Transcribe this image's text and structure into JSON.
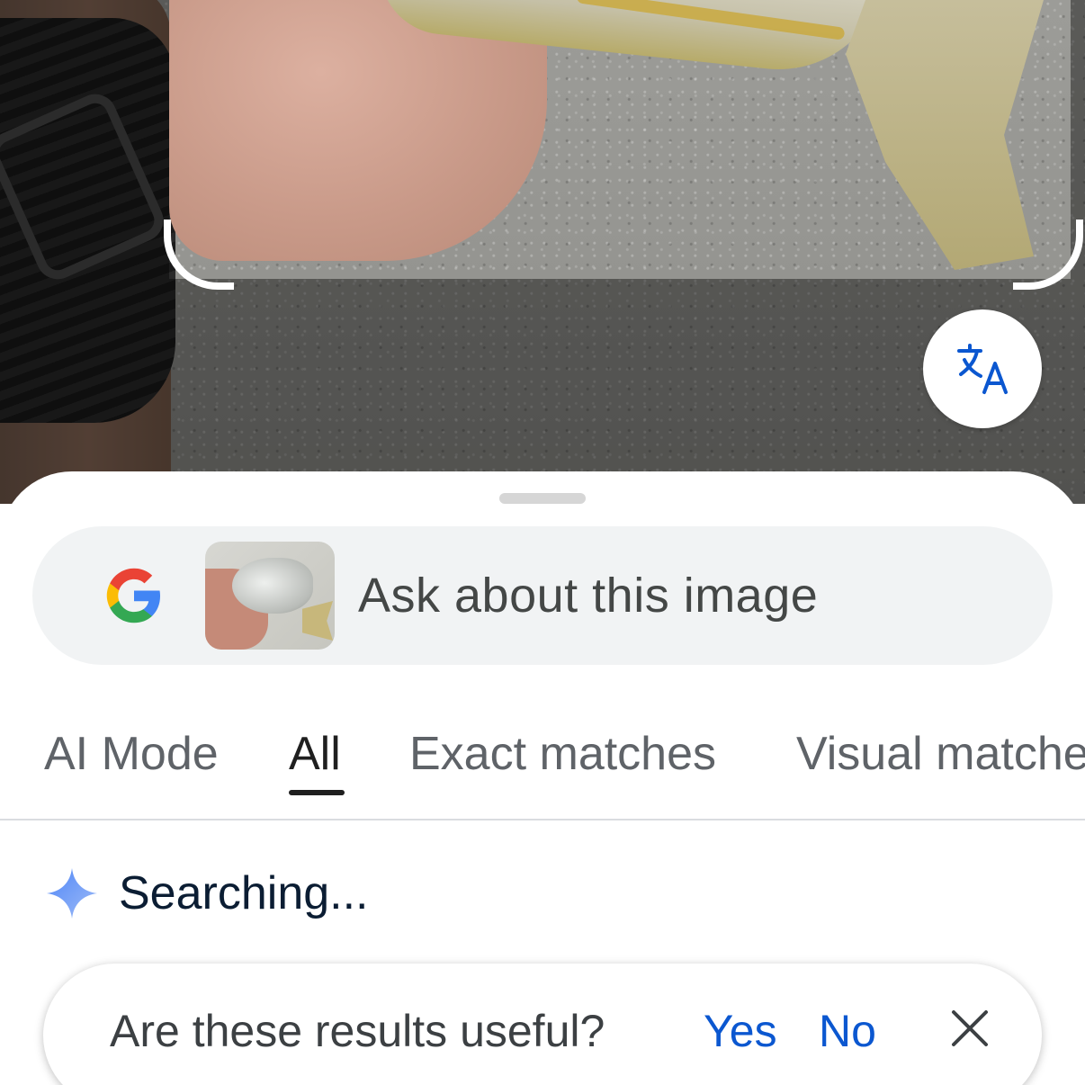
{
  "camera": {
    "translate_button_icon": "translate-icon"
  },
  "search": {
    "logo": "google-g-icon",
    "placeholder": "Ask about this image",
    "thumbnail": "fish-photo-thumbnail"
  },
  "tabs": [
    {
      "label": "AI Mode",
      "active": false
    },
    {
      "label": "All",
      "active": true
    },
    {
      "label": "Exact matches",
      "active": false
    },
    {
      "label": "Visual matches",
      "active": false
    }
  ],
  "status": {
    "icon": "sparkle-icon",
    "text": "Searching..."
  },
  "feedback": {
    "question": "Are these results useful?",
    "yes_label": "Yes",
    "no_label": "No",
    "close_icon": "close-icon"
  },
  "colors": {
    "link_blue": "#0b57d0",
    "active_tab": "#1f1f1f",
    "inactive_tab": "#5f6368",
    "search_bg": "#f1f3f4"
  }
}
